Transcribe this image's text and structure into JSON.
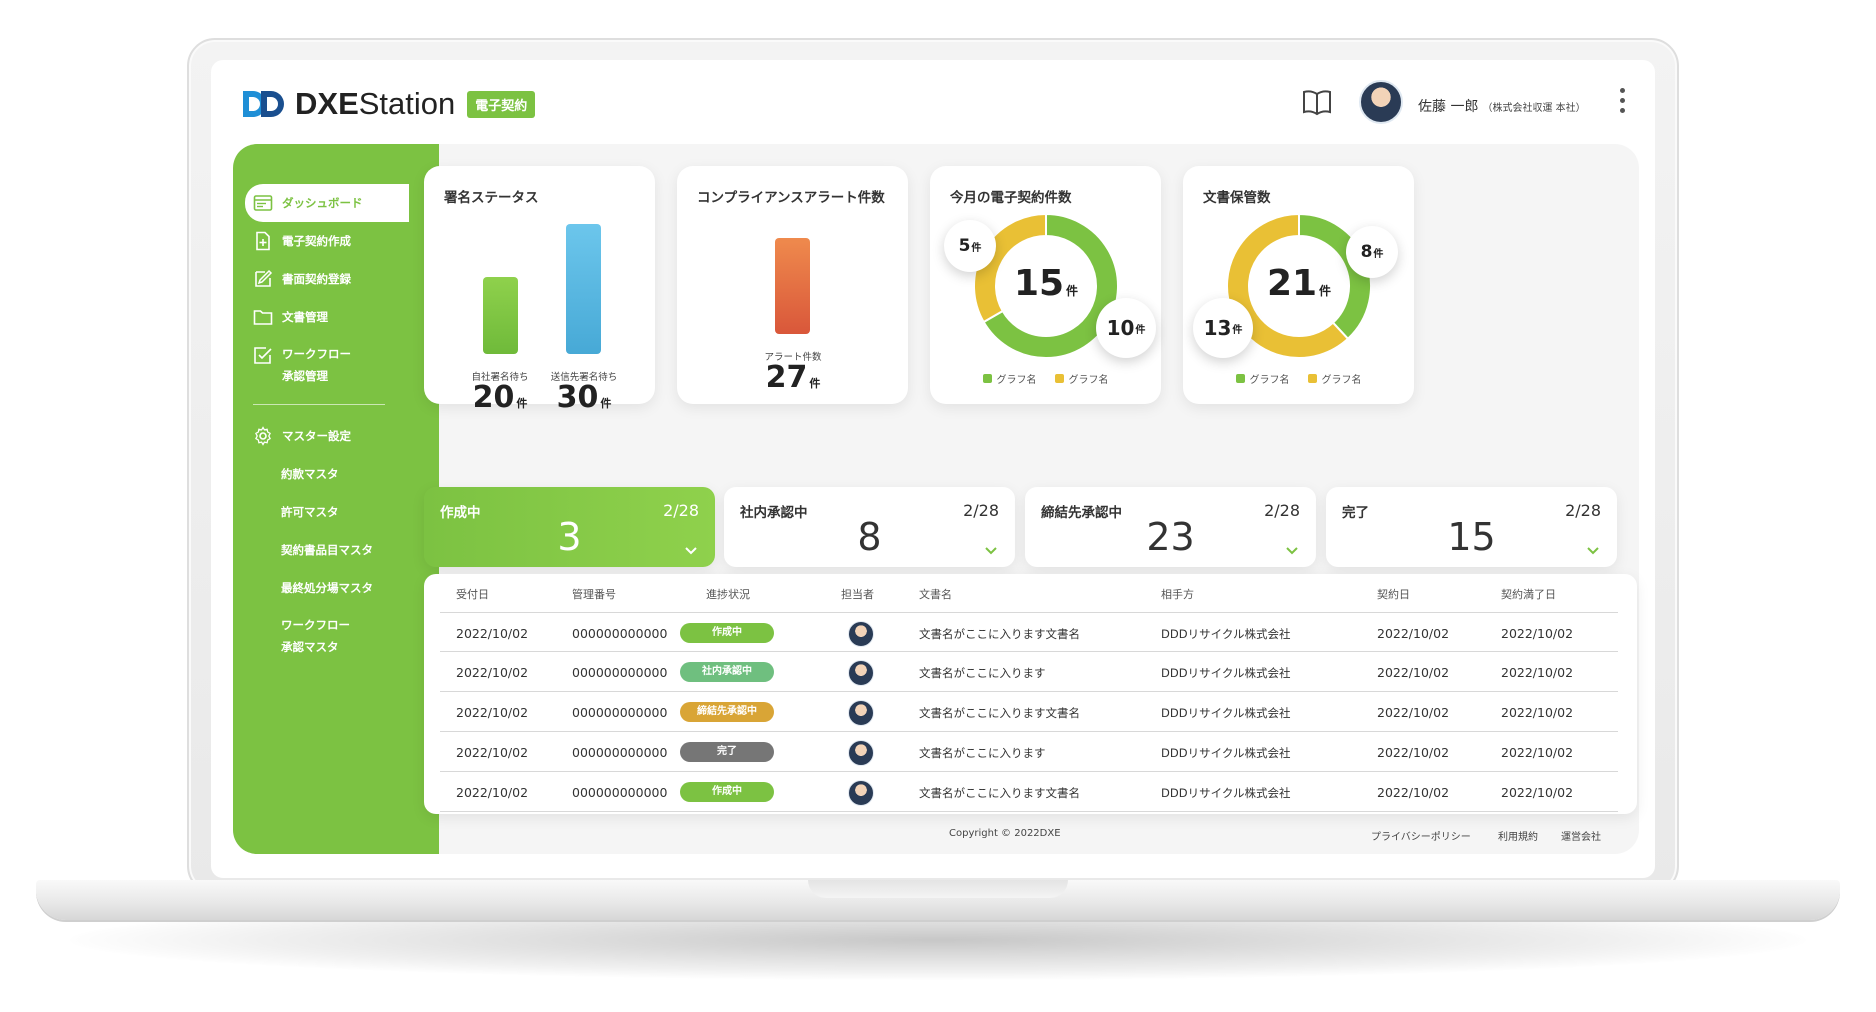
{
  "app": {
    "logo_bold": "DXE",
    "logo_light": "Station",
    "product_badge": "電子契約"
  },
  "user": {
    "name": "佐藤 一郎",
    "org": "（株式会社収運 本社）"
  },
  "sidebar": {
    "items": [
      {
        "label": "ダッシュボード",
        "icon": "dashboard-icon"
      },
      {
        "label": "電子契約作成",
        "icon": "file-plus-icon"
      },
      {
        "label": "書面契約登録",
        "icon": "edit-icon"
      },
      {
        "label": "文書管理",
        "icon": "folder-icon"
      },
      {
        "label": "ワークフロー",
        "label2": "承認管理",
        "icon": "checkbox-icon"
      }
    ],
    "master": {
      "label": "マスター設定",
      "icon": "gear-icon"
    },
    "sub_items": [
      {
        "label": "約款マスタ"
      },
      {
        "label": "許可マスタ"
      },
      {
        "label": "契約書品目マスタ"
      },
      {
        "label": "最終処分場マスタ"
      },
      {
        "label": "ワークフロー",
        "label2": "承認マスタ"
      }
    ]
  },
  "cards": {
    "signature": {
      "title": "署名ステータス",
      "unit": "件",
      "bars": [
        {
          "label": "自社署名待ち",
          "value": "20",
          "colors": [
            "#8fd14c",
            "#6fba3a"
          ]
        },
        {
          "label": "送信先署名待ち",
          "value": "30",
          "colors": [
            "#6cc6ec",
            "#47a9d6"
          ]
        }
      ]
    },
    "compliance": {
      "title": "コンプライアンスアラート件数",
      "unit": "件",
      "bars": [
        {
          "label": "アラート件数",
          "value": "27",
          "colors": [
            "#ef8a4d",
            "#d9573a"
          ]
        }
      ]
    },
    "monthly": {
      "title": "今月の電子契約件数",
      "total": "15",
      "unit": "件",
      "segments": [
        {
          "value": "10",
          "color": "#7cc242"
        },
        {
          "value": "5",
          "color": "#e9c035"
        }
      ],
      "legend": [
        {
          "label": "グラフ名",
          "color": "#7cc242"
        },
        {
          "label": "グラフ名",
          "color": "#e9c035"
        }
      ]
    },
    "storage": {
      "title": "文書保管数",
      "total": "21",
      "unit": "件",
      "segments": [
        {
          "value": "8",
          "color": "#7cc242"
        },
        {
          "value": "13",
          "color": "#e9c035"
        }
      ],
      "legend": [
        {
          "label": "グラフ名",
          "color": "#7cc242"
        },
        {
          "label": "グラフ名",
          "color": "#e9c035"
        }
      ]
    }
  },
  "status_cards": [
    {
      "label": "作成中",
      "date": "2/28",
      "value": "3",
      "active": true
    },
    {
      "label": "社内承認中",
      "date": "2/28",
      "value": "8",
      "active": false
    },
    {
      "label": "締結先承認中",
      "date": "2/28",
      "value": "23",
      "active": false
    },
    {
      "label": "完了",
      "date": "2/28",
      "value": "15",
      "active": false
    }
  ],
  "table": {
    "headers": [
      "受付日",
      "管理番号",
      "進捗状況",
      "担当者",
      "文書名",
      "相手方",
      "契約日",
      "契約満了日"
    ],
    "rows": [
      {
        "date": "2022/10/02",
        "id": "000000000000",
        "status": "作成中",
        "status_color": "#7cc242",
        "doc": "文書名がここに入ります文書名",
        "partner": "DDDリサイクル株式会社",
        "contract": "2022/10/02",
        "expiry": "2022/10/02"
      },
      {
        "date": "2022/10/02",
        "id": "000000000000",
        "status": "社内承認中",
        "status_color": "#6fbf7f",
        "doc": "文書名がここに入ります",
        "partner": "DDDリサイクル株式会社",
        "contract": "2022/10/02",
        "expiry": "2022/10/02"
      },
      {
        "date": "2022/10/02",
        "id": "000000000000",
        "status": "締結先承認中",
        "status_color": "#d9a536",
        "doc": "文書名がここに入ります文書名",
        "partner": "DDDリサイクル株式会社",
        "contract": "2022/10/02",
        "expiry": "2022/10/02"
      },
      {
        "date": "2022/10/02",
        "id": "000000000000",
        "status": "完了",
        "status_color": "#767676",
        "doc": "文書名がここに入ります",
        "partner": "DDDリサイクル株式会社",
        "contract": "2022/10/02",
        "expiry": "2022/10/02"
      },
      {
        "date": "2022/10/02",
        "id": "000000000000",
        "status": "作成中",
        "status_color": "#7cc242",
        "doc": "文書名がここに入ります文書名",
        "partner": "DDDリサイクル株式会社",
        "contract": "2022/10/02",
        "expiry": "2022/10/02"
      }
    ]
  },
  "footer": {
    "copyright": "Copyright © 2022DXE",
    "links": [
      "プライバシーポリシー",
      "利用規約",
      "運営会社"
    ]
  },
  "colors": {
    "accent": "#7cc242",
    "yellow": "#e9c035"
  }
}
